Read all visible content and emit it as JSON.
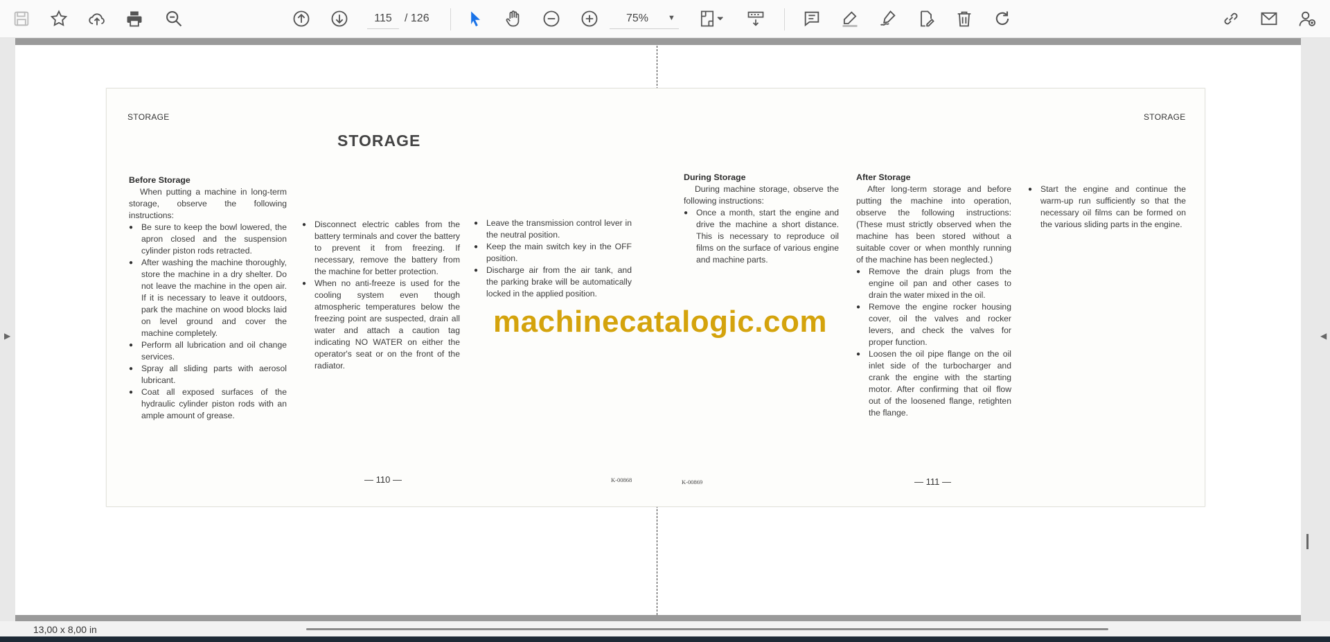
{
  "toolbar": {
    "page_current": "115",
    "page_total": "/  126",
    "zoom": "75%",
    "icons": [
      "save-icon",
      "star-icon",
      "upload-icon",
      "print-icon",
      "zoom-search-icon",
      "arrow-up-icon",
      "arrow-down-icon",
      "pointer-icon",
      "hand-icon",
      "zoom-out-icon",
      "zoom-in-icon",
      "fit-page-icon",
      "scroll-mode-icon",
      "comment-icon",
      "highlight-icon",
      "sign-icon",
      "edit-icon",
      "delete-icon",
      "rotate-icon",
      "link-icon",
      "mail-icon",
      "account-icon"
    ]
  },
  "document": {
    "left": {
      "header": "STORAGE",
      "title": "STORAGE",
      "col1": {
        "heading": "Before Storage",
        "intro": "When putting a machine in long-term storage, observe the following instructions:",
        "bullets": [
          "Be sure to keep the bowl lowered, the apron closed and the suspension cylinder piston rods retracted.",
          "After washing the machine thoroughly, store the machine in a dry shelter. Do not leave the machine in the open air. If it is necessary to leave it outdoors, park the machine on wood blocks laid on level ground and cover the machine completely.",
          "Perform all lubrication and oil change services.",
          "Spray all sliding parts with aerosol lubricant.",
          "Coat all exposed surfaces of the hydraulic cylinder piston rods with an ample amount of grease."
        ]
      },
      "col2": {
        "bullets": [
          "Disconnect electric cables from the battery terminals and cover the battery to prevent it from freezing. If necessary, remove the battery from the machine for better protection.",
          "When no anti-freeze is used for the cooling system even though atmospheric temperatures below the freezing point are suspected, drain all water and attach a caution tag indicating NO WATER on either the operator's seat or on the front of the radiator."
        ]
      },
      "col3": {
        "bullets": [
          "Leave the transmission control lever in the neutral position.",
          "Keep the main switch key in the OFF position.",
          "Discharge air from the air tank, and the parking brake will be automatically locked in the applied position."
        ]
      },
      "page_number": "— 110 —",
      "code": "K-00868"
    },
    "right": {
      "header": "STORAGE",
      "col1": {
        "heading": "During Storage",
        "intro": "During machine storage, observe the following instructions:",
        "bullets": [
          "Once a month, start the engine and drive the machine a short distance. This is necessary to reproduce oil films on the surface of various engine and machine parts."
        ]
      },
      "col2": {
        "heading": "After Storage",
        "intro": "After long-term storage and before putting the machine into operation, observe the following instructions: (These must strictly observed when the machine has been stored without a suitable cover or when monthly running of the machine has been neglected.)",
        "bullets": [
          "Remove the drain plugs from the engine oil pan and other cases to drain the water mixed in the oil.",
          "Remove the engine rocker housing cover, oil the valves and rocker levers, and check the valves for proper function.",
          "Loosen the oil pipe flange on the oil inlet side of the turbocharger and crank the engine with the starting motor. After confirming that oil flow out of the loosened flange, retighten the flange."
        ]
      },
      "col3": {
        "bullets": [
          "Start the engine and continue the warm-up run sufficiently so that the necessary oil films can be formed on the various sliding parts in the engine."
        ]
      },
      "page_number": "— 111 —",
      "code": "K-00869"
    },
    "watermark": "machinecatalogic.com"
  },
  "status": {
    "page_size": "13,00 x 8,00 in"
  },
  "colors": {
    "accent": "#1a73e8",
    "watermark": "#d4a30c",
    "icon": "#555555"
  }
}
